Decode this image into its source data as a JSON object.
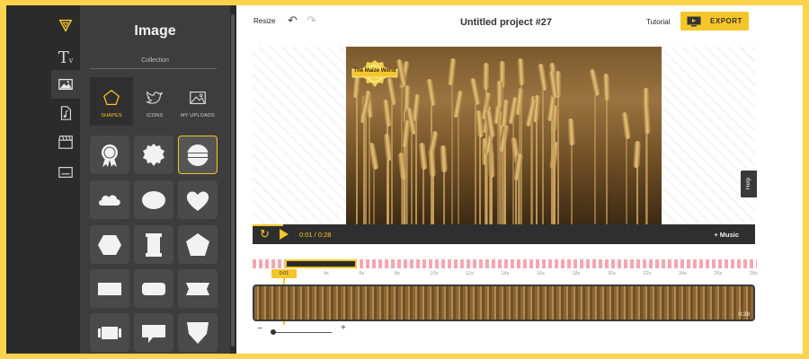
{
  "toolbar": {
    "resize_label": "Resize",
    "undo_icon": "undo-icon",
    "redo_icon": "redo-icon",
    "project_title": "Untitled project #27",
    "tutorial_label": "Tutorial",
    "export_label": "EXPORT"
  },
  "rail": {
    "items": [
      {
        "name": "logo-icon"
      },
      {
        "name": "text-icon",
        "glyph": "T"
      },
      {
        "name": "image-icon",
        "active": true
      },
      {
        "name": "music-file-icon"
      },
      {
        "name": "clapperboard-icon"
      },
      {
        "name": "subtitles-icon"
      }
    ]
  },
  "panel": {
    "title": "Image",
    "subtitle": "Collection",
    "categories": [
      {
        "label": "SHAPES",
        "icon": "pentagon-icon",
        "active": true
      },
      {
        "label": "ICONS",
        "icon": "bird-icon"
      },
      {
        "label": "MY UPLOADS",
        "icon": "picture-icon"
      }
    ],
    "tiles": [
      "award-ribbon",
      "badge-scalloped",
      "badge-banner",
      "cloud",
      "ellipse",
      "heart",
      "hexagon",
      "shield-banner",
      "pentagon",
      "rectangle",
      "rounded-rectangle",
      "ribbon-flag",
      "scroll",
      "speech-bubble",
      "pennant"
    ]
  },
  "canvas": {
    "badge_text": "The Maize World"
  },
  "player": {
    "time": "0:01 / 0:28",
    "music_label": "+ Music",
    "progress_fraction": 0.06
  },
  "timeline": {
    "marker_label": "0:01",
    "ticks": [
      "4s",
      "6s",
      "8s",
      "10s",
      "12s",
      "14s",
      "16s",
      "18s",
      "20s",
      "22s",
      "24s",
      "26s",
      "28s"
    ],
    "clip_duration": "0:28",
    "zoom_minus": "−",
    "zoom_plus": "+"
  },
  "help_label": "Help",
  "colors": {
    "accent": "#f5c62a",
    "frame": "#fcd34d",
    "panel": "#3d3d3d",
    "ruler": "#f7a6b0"
  }
}
